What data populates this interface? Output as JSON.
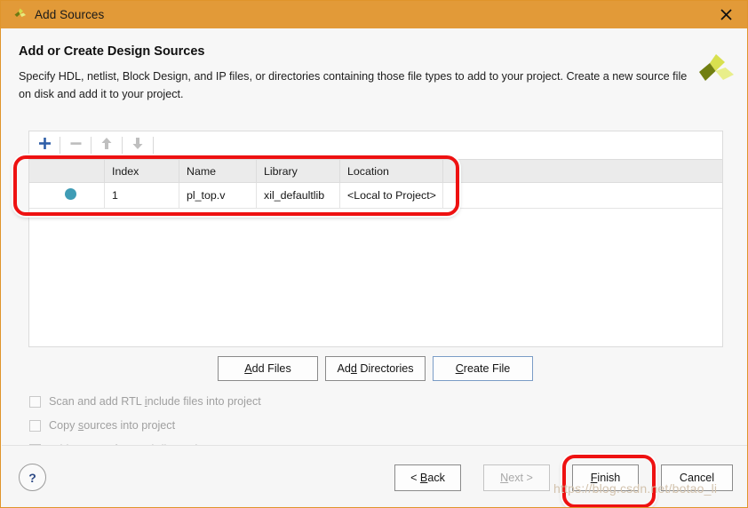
{
  "window": {
    "title": "Add Sources",
    "title_icon": "vivado-logo-icon",
    "close_label": "✕",
    "accent_color": "#e29a38"
  },
  "header": {
    "heading": "Add or Create Design Sources",
    "description": "Specify HDL, netlist, Block Design, and IP files, or directories containing those file types to add to your project. Create a new source file on disk and add it to your project.",
    "logo": "xilinx-pinwheel-logo-icon"
  },
  "toolbar": {
    "add_icon": "plus-icon",
    "remove_icon": "minus-icon",
    "move_up_icon": "arrow-up-icon",
    "move_down_icon": "arrow-down-icon",
    "add_color": "#2f5fa8",
    "disabled_color": "#bdbdbd"
  },
  "table": {
    "columns": [
      "",
      "Index",
      "Name",
      "Library",
      "Location",
      ""
    ],
    "rows": [
      {
        "status_icon": "blue-dot-icon",
        "index": "1",
        "name": "pl_top.v",
        "library": "xil_defaultlib",
        "location": "<Local to Project>"
      }
    ],
    "dot_color": "#3f9cb5"
  },
  "actions": {
    "add_files": {
      "pre": "A",
      "mnemonic": "",
      "label": "Add Files",
      "m_index": 0
    },
    "add_files_label": "Add Files",
    "add_directories_label": "Add Directories",
    "create_file_label": "Create File"
  },
  "options": [
    {
      "label": "Scan and add RTL include files into project",
      "checked": false,
      "enabled": false
    },
    {
      "label": "Copy sources into project",
      "checked": false,
      "enabled": false
    },
    {
      "label": "Add sources from subdirectories",
      "checked": true,
      "enabled": false
    }
  ],
  "footer": {
    "help_label": "?",
    "back_label": "< Back",
    "next_label": "Next >",
    "finish_label": "Finish",
    "cancel_label": "Cancel"
  },
  "watermark": "https://blog.csdn.net/botao_li"
}
